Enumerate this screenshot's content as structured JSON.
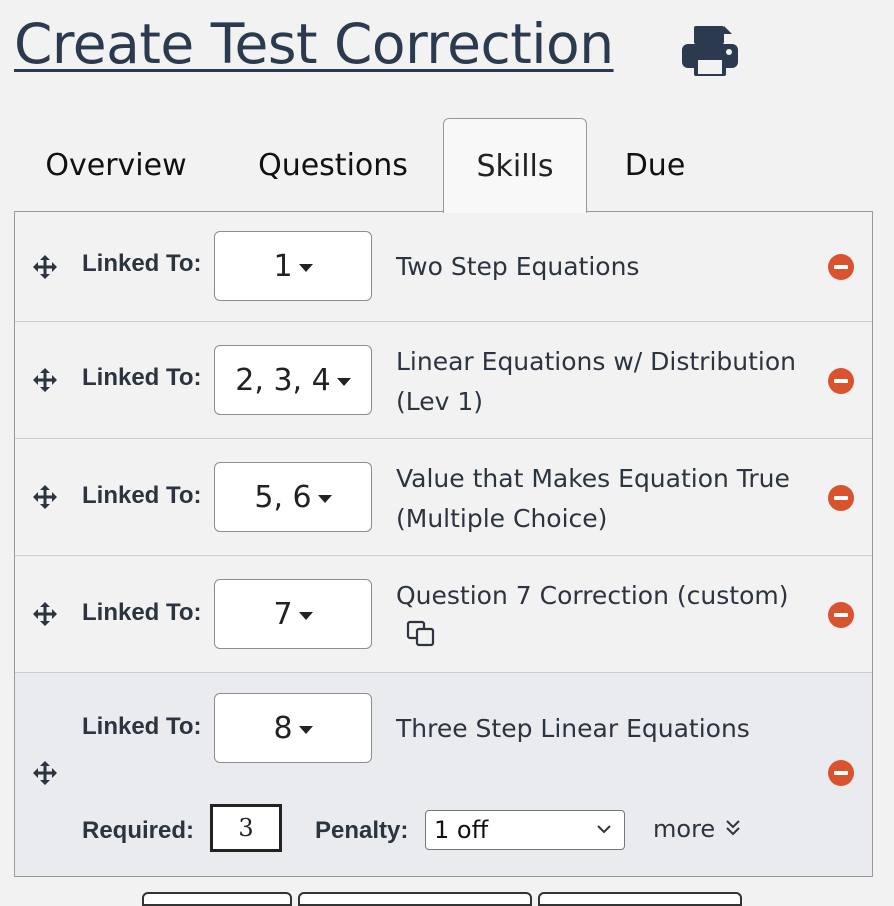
{
  "page": {
    "title": "Create Test Correction"
  },
  "tabs": [
    {
      "label": "Overview"
    },
    {
      "label": "Questions"
    },
    {
      "label": "Skills"
    },
    {
      "label": "Due"
    }
  ],
  "active_tab": "Skills",
  "skills": [
    {
      "linked_label": "Linked To:",
      "linked_value": "1",
      "name_line1": "Two Step Equations",
      "name_line2": ""
    },
    {
      "linked_label": "Linked To:",
      "linked_value": "2, 3, 4",
      "name_line1": "Linear Equations w/ Distribution",
      "name_line2": "(Lev 1)"
    },
    {
      "linked_label": "Linked To:",
      "linked_value": "5, 6",
      "name_line1": "Value that Makes Equation True",
      "name_line2": "(Multiple Choice)"
    },
    {
      "linked_label": "Linked To:",
      "linked_value": "7",
      "name_line1": "Question 7 Correction (custom)",
      "name_line2": ""
    },
    {
      "linked_label": "Linked To:",
      "linked_value": "8",
      "name_line1": "Three Step Linear Equations",
      "name_line2": ""
    }
  ],
  "expanded": {
    "required_label": "Required:",
    "required_value": "3",
    "penalty_label": "Penalty:",
    "penalty_value": "1 off",
    "more_label": "more"
  },
  "colors": {
    "title": "#2b3a4e",
    "remove": "#d9532f",
    "text": "#2c3440"
  },
  "icons": {
    "print": "print-icon",
    "move": "move-icon",
    "remove": "remove-icon",
    "copy": "copy-icon",
    "more": "double-chevron-down-icon"
  }
}
